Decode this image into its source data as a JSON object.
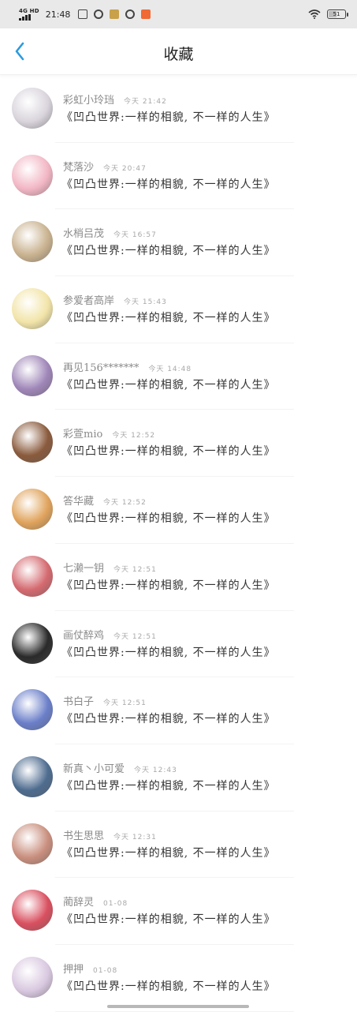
{
  "status_bar": {
    "network": "4G HD",
    "time": "21:48",
    "battery": "51",
    "colors": {
      "app_icon_1": "#444444",
      "app_icon_2": "#444444",
      "app_icon_3": "#c9a14a",
      "app_icon_4": "#444444",
      "app_icon_5": "#f06a35"
    }
  },
  "header": {
    "title": "收藏",
    "back_icon": "chevron-left-icon",
    "accent": "#2a9be0"
  },
  "items": [
    {
      "name": "彩虹小玲珰",
      "time": "今天 21:42",
      "message": "《凹凸世界:一样的相貌, 不一样的人生》",
      "avatar_color": "#d9d4dc"
    },
    {
      "name": "梵落沙",
      "time": "今天 20:47",
      "message": "《凹凸世界:一样的相貌, 不一样的人生》",
      "avatar_color": "#f2b6c4"
    },
    {
      "name": "水梢吕茂",
      "time": "今天 16:57",
      "message": "《凹凸世界:一样的相貌, 不一样的人生》",
      "avatar_color": "#c9b28f"
    },
    {
      "name": "参爱者高岸",
      "time": "今天 15:43",
      "message": "《凹凸世界:一样的相貌, 不一样的人生》",
      "avatar_color": "#f2e4a8"
    },
    {
      "name": "再见156*******",
      "time": "今天 14:48",
      "message": "《凹凸世界:一样的相貌, 不一样的人生》",
      "avatar_color": "#9f86b8"
    },
    {
      "name": "彩萱mio",
      "time": "今天 12:52",
      "message": "《凹凸世界:一样的相貌, 不一样的人生》",
      "avatar_color": "#8a5b3d"
    },
    {
      "name": "答华藏",
      "time": "今天 12:52",
      "message": "《凹凸世界:一样的相貌, 不一样的人生》",
      "avatar_color": "#e0a35c"
    },
    {
      "name": "七濑一钥",
      "time": "今天 12:51",
      "message": "《凹凸世界:一样的相貌, 不一样的人生》",
      "avatar_color": "#d46a70"
    },
    {
      "name": "画仗醉鸡",
      "time": "今天 12:51",
      "message": "《凹凸世界:一样的相貌, 不一样的人生》",
      "avatar_color": "#2a2a2a"
    },
    {
      "name": "书白子",
      "time": "今天 12:51",
      "message": "《凹凸世界:一样的相貌, 不一样的人生》",
      "avatar_color": "#6b7fc9"
    },
    {
      "name": "新真丶小可爱",
      "time": "今天 12:43",
      "message": "《凹凸世界:一样的相貌, 不一样的人生》",
      "avatar_color": "#4e6c8f"
    },
    {
      "name": "书生思思",
      "time": "今天 12:31",
      "message": "《凹凸世界:一样的相貌, 不一样的人生》",
      "avatar_color": "#c98f7e"
    },
    {
      "name": "蔺辞灵",
      "time": "01-08",
      "message": "《凹凸世界:一样的相貌, 不一样的人生》",
      "avatar_color": "#d95060"
    },
    {
      "name": "押押",
      "time": "01-08",
      "message": "《凹凸世界:一样的相貌, 不一样的人生》",
      "avatar_color": "#d9c8e0"
    }
  ]
}
